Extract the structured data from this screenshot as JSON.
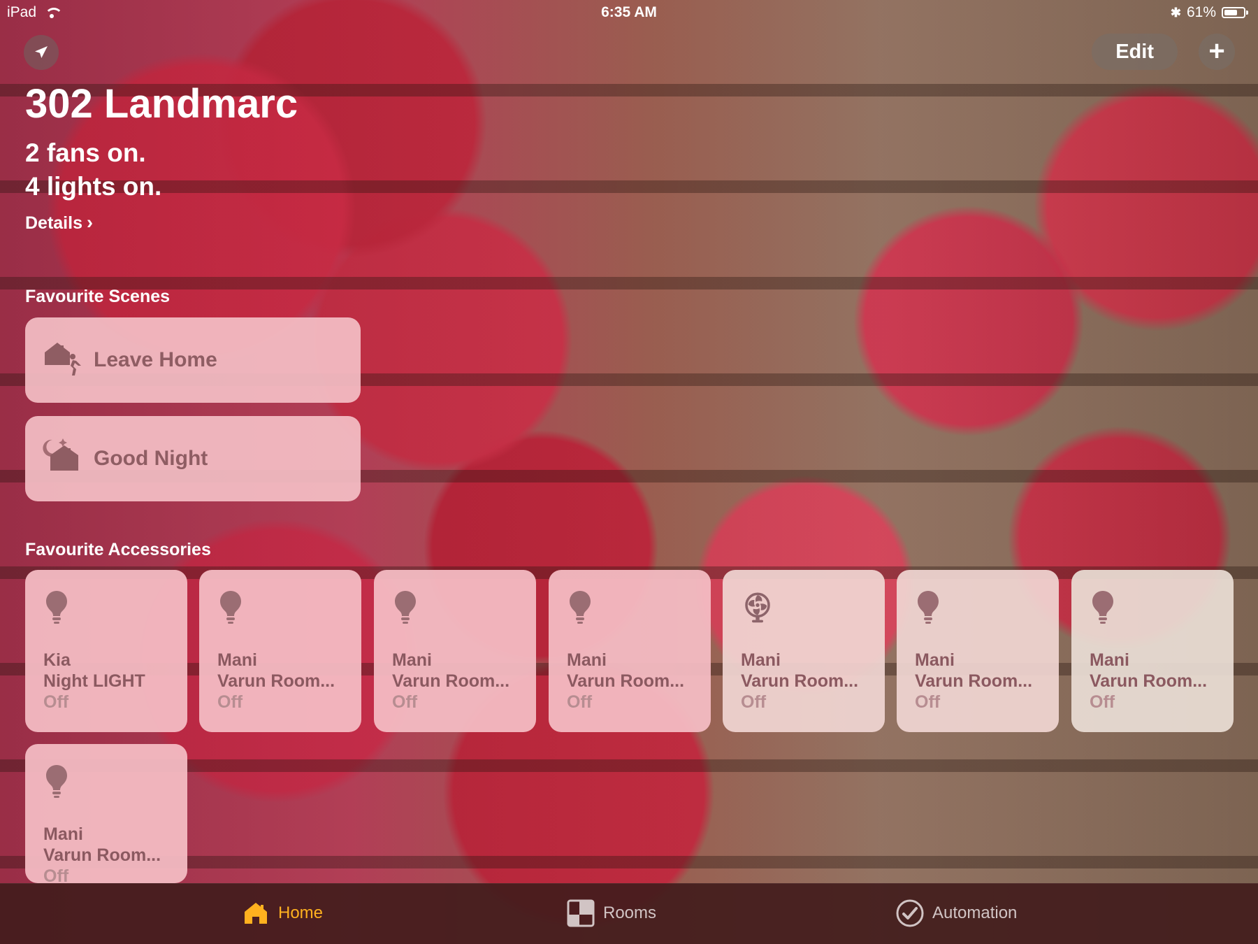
{
  "status_bar": {
    "device": "iPad",
    "time": "6:35 AM",
    "battery": "61%"
  },
  "header": {
    "edit_label": "Edit",
    "plus_symbol": "+"
  },
  "home": {
    "title": "302 Landmarc",
    "summary_1": "2 fans on.",
    "summary_2": "4 lights on.",
    "details_label": "Details",
    "details_chevron": "›"
  },
  "sections": {
    "scenes": "Favourite Scenes",
    "accessories": "Favourite Accessories"
  },
  "scenes": [
    {
      "label": "Leave Home",
      "icon": "leave-home-icon"
    },
    {
      "label": "Good Night",
      "icon": "good-night-icon"
    }
  ],
  "accessories": [
    {
      "line1": "Kia",
      "line2": "Night LIGHT",
      "status": "Off",
      "icon": "bulb-icon"
    },
    {
      "line1": "Mani",
      "line2": "Varun Room...",
      "status": "Off",
      "icon": "bulb-icon"
    },
    {
      "line1": "Mani",
      "line2": "Varun Room...",
      "status": "Off",
      "icon": "bulb-icon"
    },
    {
      "line1": "Mani",
      "line2": "Varun Room...",
      "status": "Off",
      "icon": "bulb-icon"
    },
    {
      "line1": "Mani",
      "line2": "Varun Room...",
      "status": "Off",
      "icon": "fan-icon"
    },
    {
      "line1": "Mani",
      "line2": "Varun Room...",
      "status": "Off",
      "icon": "bulb-icon"
    },
    {
      "line1": "Mani",
      "line2": "Varun Room...",
      "status": "Off",
      "icon": "bulb-icon"
    },
    {
      "line1": "Mani",
      "line2": "Varun Room...",
      "status": "Off",
      "icon": "bulb-icon"
    }
  ],
  "tabbar": {
    "home": "Home",
    "rooms": "Rooms",
    "automation": "Automation"
  },
  "colors": {
    "accent": "#ffb11f",
    "card_pink": "#f4bcc3",
    "card_text": "#8b5960",
    "tab_bg": "#421c1c"
  }
}
